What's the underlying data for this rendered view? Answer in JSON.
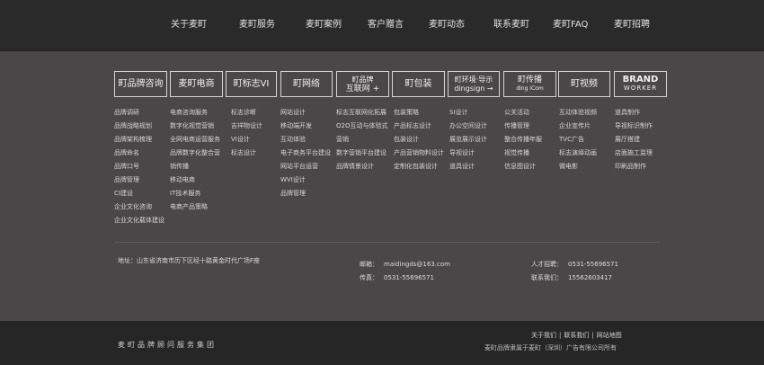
{
  "nav": {
    "items": [
      "关于麦町",
      "麦町服务",
      "麦町案例",
      "客户赠言",
      "麦町动态",
      "联系麦町",
      "麦町FAQ",
      "麦町招聘"
    ]
  },
  "services": [
    {
      "label": "町品牌咨询"
    },
    {
      "label": "麦町电商"
    },
    {
      "label": "町标志VI"
    },
    {
      "label": "町网络"
    },
    {
      "label1": "町品牌",
      "label2": "互联网 +"
    },
    {
      "label": "町包装"
    },
    {
      "label1": "町环境·导示",
      "label2": "dingsign →"
    },
    {
      "label1": "町传播",
      "label2": "ding iCom"
    },
    {
      "label": "町视频"
    },
    {
      "label1": "BRAND",
      "label2": "WORKER"
    }
  ],
  "columns": [
    [
      "品牌调研",
      "品牌战略规划",
      "品牌架构梳理",
      "品牌命名",
      "品牌口号",
      "品牌管理",
      "CI建设",
      "企业文化咨询",
      "企业文化载体建设"
    ],
    [
      "电商咨询服务",
      "数字化视觉营销",
      "全网电商运营服务",
      "品牌数字化整合营",
      "销传播",
      "移动电商",
      "IT技术服务",
      "电商产品策略"
    ],
    [
      "标志诊断",
      "吉祥物设计",
      "VI设计",
      "标志设计"
    ],
    [
      "网站设计",
      "移动端开发",
      "互动体验",
      "电子商务平台建设",
      "网站平台运营",
      "WVI设计",
      "品牌管理"
    ],
    [
      "标志互联网化拓展",
      "O2O互动与体验式",
      "营销",
      "数字营销平台建设",
      "品牌情景设计"
    ],
    [
      "包装策略",
      "产品标志设计",
      "包装设计",
      "产品营销物料设计",
      "定制化包装设计"
    ],
    [
      "SI设计",
      "办公空间设计",
      "展览展示设计",
      "导视设计",
      "道具设计"
    ],
    [
      "公关活动",
      "传播管理",
      "整合传播年服",
      "视觉传播",
      "信息图设计"
    ],
    [
      "互动体验视频",
      "企业宣传片",
      "TVC广告",
      "标志演绎动画",
      "微电影"
    ],
    [
      "道具制作",
      "导视标识制作",
      "展厅搭建",
      "店面施工监理",
      "印刷品制作"
    ]
  ],
  "contact": {
    "address_label": "地址：",
    "address": "山东省济南市历下区经十路黄金时代广场F座",
    "email_label": "邮箱：",
    "email": "maidingds@163.com",
    "fax_label": "传真：",
    "fax": "0531-55696571",
    "hr_label": "人才招聘：",
    "hr": "0531-55696571",
    "contact_label": "联系我们：",
    "contact": "15562603417"
  },
  "footer": {
    "company": "麦町品牌顾问服务集团",
    "links": [
      "关于我们",
      "联系我们",
      "网站地图"
    ],
    "separator": "|",
    "copyright": "麦町品牌隶属于麦町（深圳）广告有限公司所有"
  }
}
